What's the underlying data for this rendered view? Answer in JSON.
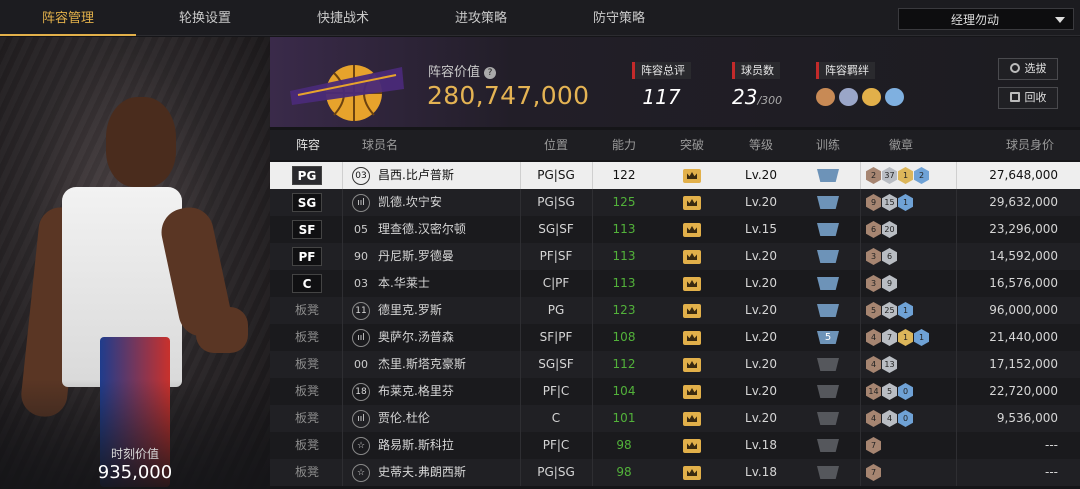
{
  "nav": {
    "tabs": [
      "阵容管理",
      "轮换设置",
      "快捷战术",
      "进攻策略",
      "防守策略"
    ],
    "manager_select": "经理勿动"
  },
  "player_card": {
    "moment_label": "时刻价值",
    "moment_value": "935,000"
  },
  "header": {
    "value_label": "阵容价值",
    "value": "280,747,000",
    "stats": [
      {
        "title": "阵容总评",
        "value": "117"
      },
      {
        "title": "球员数",
        "value": "23",
        "suffix": "/300"
      },
      {
        "title": "阵容羁绊"
      }
    ],
    "buttons": {
      "select": "选拔",
      "recycle": "回收"
    },
    "bond_icon_colors": [
      "#c88a55",
      "#9aa6c8",
      "#e2b04a",
      "#7fb0e0"
    ]
  },
  "table": {
    "headers": [
      "阵容",
      "球员名",
      "位置",
      "能力",
      "突破",
      "等级",
      "训练",
      "徽章",
      "球员身价"
    ],
    "rows": [
      {
        "slot": "PG",
        "bench": false,
        "num": "03",
        "num_style": "circle",
        "name": "昌西.比卢普斯",
        "position": "PG|SG",
        "ability": "122",
        "level": "Lv.20",
        "train": "",
        "train_style": "blue",
        "badges": [
          {
            "t": "bronze",
            "v": "2"
          },
          {
            "t": "silver",
            "v": "37"
          },
          {
            "t": "gold",
            "v": "1"
          },
          {
            "t": "blue",
            "v": "2"
          }
        ],
        "worth": "27,648,000",
        "selected": true
      },
      {
        "slot": "SG",
        "bench": false,
        "num": "ııl",
        "num_style": "circle",
        "name": "凯德.坎宁安",
        "position": "PG|SG",
        "ability": "125",
        "level": "Lv.20",
        "train": "",
        "train_style": "blue",
        "badges": [
          {
            "t": "bronze",
            "v": "9"
          },
          {
            "t": "silver",
            "v": "15"
          },
          {
            "t": "blue",
            "v": "1"
          }
        ],
        "worth": "29,632,000"
      },
      {
        "slot": "SF",
        "bench": false,
        "num": "05",
        "num_style": "plain",
        "name": "理查德.汉密尔顿",
        "position": "SG|SF",
        "ability": "113",
        "level": "Lv.15",
        "train": "",
        "train_style": "blue",
        "badges": [
          {
            "t": "bronze",
            "v": "6"
          },
          {
            "t": "silver",
            "v": "20"
          }
        ],
        "worth": "23,296,000"
      },
      {
        "slot": "PF",
        "bench": false,
        "num": "90",
        "num_style": "plain",
        "name": "丹尼斯.罗德曼",
        "position": "PF|SF",
        "ability": "113",
        "level": "Lv.20",
        "train": "",
        "train_style": "blue",
        "badges": [
          {
            "t": "bronze",
            "v": "3"
          },
          {
            "t": "silver",
            "v": "6"
          }
        ],
        "worth": "14,592,000"
      },
      {
        "slot": "C",
        "bench": false,
        "num": "03",
        "num_style": "plain",
        "name": "本.华莱士",
        "position": "C|PF",
        "ability": "113",
        "level": "Lv.20",
        "train": "",
        "train_style": "blue",
        "badges": [
          {
            "t": "bronze",
            "v": "3"
          },
          {
            "t": "silver",
            "v": "9"
          }
        ],
        "worth": "16,576,000"
      },
      {
        "slot": "板凳",
        "bench": true,
        "num": "11",
        "num_style": "circle",
        "name": "德里克.罗斯",
        "position": "PG",
        "ability": "123",
        "level": "Lv.20",
        "train": "",
        "train_style": "blue",
        "badges": [
          {
            "t": "bronze",
            "v": "5"
          },
          {
            "t": "silver",
            "v": "25"
          },
          {
            "t": "blue",
            "v": "1"
          }
        ],
        "worth": "96,000,000"
      },
      {
        "slot": "板凳",
        "bench": true,
        "num": "ııl",
        "num_style": "circle",
        "name": "奥萨尔.汤普森",
        "position": "SF|PF",
        "ability": "108",
        "level": "Lv.20",
        "train": "5",
        "train_style": "blue",
        "badges": [
          {
            "t": "bronze",
            "v": "4"
          },
          {
            "t": "silver",
            "v": "7"
          },
          {
            "t": "gold",
            "v": "1"
          },
          {
            "t": "blue",
            "v": "1"
          }
        ],
        "worth": "21,440,000"
      },
      {
        "slot": "板凳",
        "bench": true,
        "num": "00",
        "num_style": "plain",
        "name": "杰里.斯塔克豪斯",
        "position": "SG|SF",
        "ability": "112",
        "level": "Lv.20",
        "train": "",
        "train_style": "dim",
        "badges": [
          {
            "t": "bronze",
            "v": "4"
          },
          {
            "t": "silver",
            "v": "13"
          }
        ],
        "worth": "17,152,000"
      },
      {
        "slot": "板凳",
        "bench": true,
        "num": "18",
        "num_style": "circle",
        "name": "布莱克.格里芬",
        "position": "PF|C",
        "ability": "104",
        "level": "Lv.20",
        "train": "",
        "train_style": "dim",
        "badges": [
          {
            "t": "bronze",
            "v": "14"
          },
          {
            "t": "silver",
            "v": "5"
          },
          {
            "t": "blue",
            "v": "0"
          }
        ],
        "worth": "22,720,000"
      },
      {
        "slot": "板凳",
        "bench": true,
        "num": "ııl",
        "num_style": "circle",
        "name": "贾伦.杜伦",
        "position": "C",
        "ability": "101",
        "level": "Lv.20",
        "train": "",
        "train_style": "dim",
        "badges": [
          {
            "t": "bronze",
            "v": "4"
          },
          {
            "t": "silver",
            "v": "4"
          },
          {
            "t": "blue",
            "v": "0"
          }
        ],
        "worth": "9,536,000"
      },
      {
        "slot": "板凳",
        "bench": true,
        "num": "☆",
        "num_style": "circle",
        "name": "路易斯.斯科拉",
        "position": "PF|C",
        "ability": "98",
        "level": "Lv.18",
        "train": "",
        "train_style": "dim",
        "badges": [
          {
            "t": "bronze",
            "v": "7"
          }
        ],
        "worth": "---"
      },
      {
        "slot": "板凳",
        "bench": true,
        "num": "☆",
        "num_style": "circle",
        "name": "史蒂夫.弗朗西斯",
        "position": "PG|SG",
        "ability": "98",
        "level": "Lv.18",
        "train": "",
        "train_style": "dim",
        "badges": [
          {
            "t": "bronze",
            "v": "7"
          }
        ],
        "worth": "---"
      }
    ]
  },
  "colors": {
    "accent": "#e2b04a",
    "ability_green": "#52b23a",
    "value_gold": "#e4b353"
  }
}
